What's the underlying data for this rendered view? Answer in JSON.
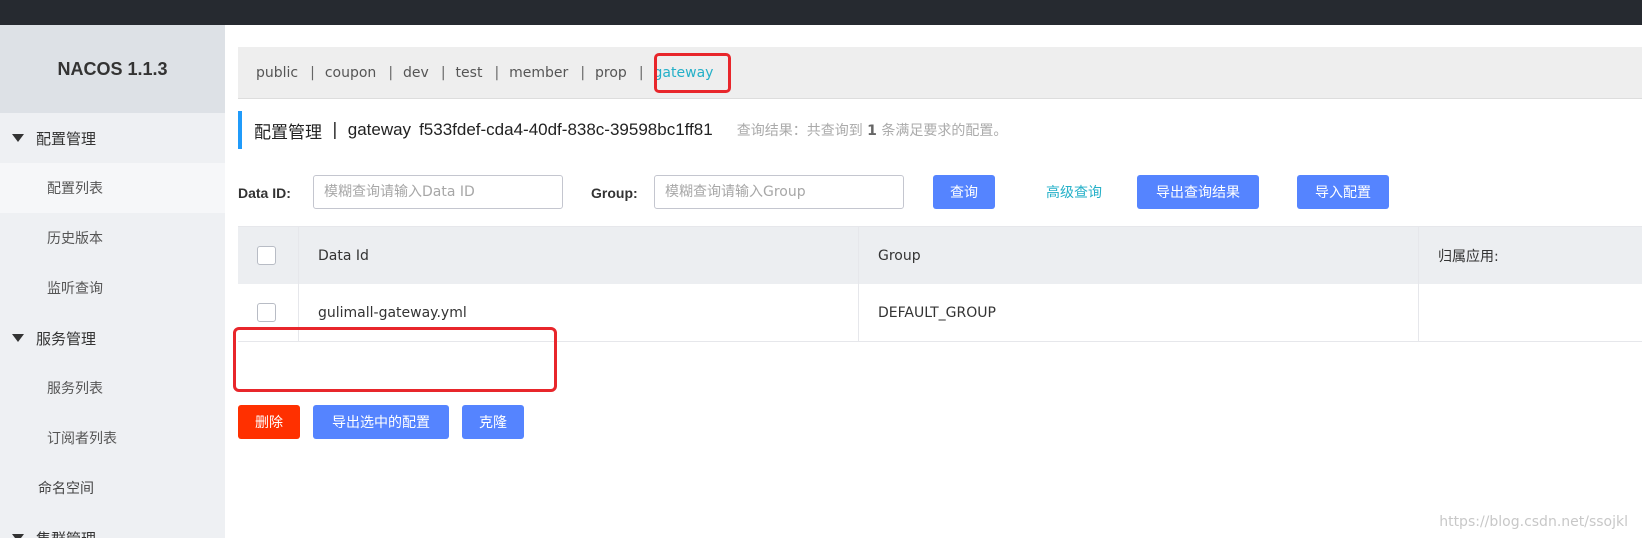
{
  "app": {
    "brand": "NACOS 1.1.3"
  },
  "sidebar": {
    "groups": [
      {
        "label": "配置管理",
        "items": [
          "配置列表",
          "历史版本",
          "监听查询"
        ]
      },
      {
        "label": "服务管理",
        "items": [
          "服务列表",
          "订阅者列表"
        ]
      }
    ],
    "plain_item": "命名空间",
    "cut_group": "集群管理"
  },
  "namespaces": {
    "items": [
      "public",
      "coupon",
      "dev",
      "test",
      "member",
      "prop",
      "gateway"
    ],
    "separator": "|",
    "current": "gateway"
  },
  "title": {
    "main": "配置管理",
    "sep": "|",
    "namespace": "gateway",
    "namespace_id": "f533fdef-cda4-40df-838c-39598bc1ff81",
    "result_prefix": "查询结果：共查询到",
    "result_count": "1",
    "result_suffix": "条满足要求的配置。"
  },
  "search": {
    "dataid_label": "Data ID:",
    "dataid_placeholder": "模糊查询请输入Data ID",
    "group_label": "Group:",
    "group_placeholder": "模糊查询请输入Group",
    "query_button": "查询",
    "advanced_link": "高级查询",
    "export_button": "导出查询结果",
    "import_button": "导入配置"
  },
  "table": {
    "headers": [
      "Data Id",
      "Group",
      "归属应用:"
    ],
    "rows": [
      {
        "data_id": "gulimall-gateway.yml",
        "group": "DEFAULT_GROUP",
        "app": ""
      }
    ]
  },
  "actions": {
    "delete": "删除",
    "export_selected": "导出选中的配置",
    "clone": "克隆"
  },
  "colors": {
    "primary": "#5584ff",
    "danger": "#ff3000",
    "link": "#24b0c8",
    "highlight": "#e8262b"
  },
  "watermark": "https://blog.csdn.net/ssojkl"
}
